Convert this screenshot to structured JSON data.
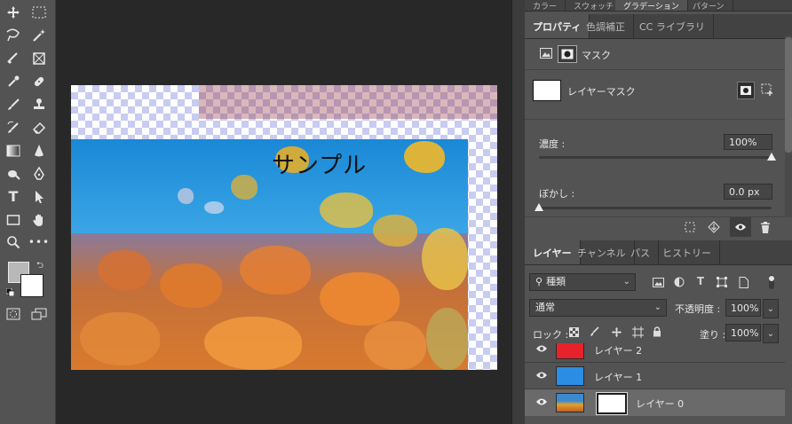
{
  "tools": [
    {
      "name": "move-tool-icon",
      "glyph": "✥"
    },
    {
      "name": "marquee-tool-icon",
      "glyph": "⬚"
    },
    {
      "name": "lasso-tool-icon",
      "glyph": "➰"
    },
    {
      "name": "magic-wand-tool-icon",
      "glyph": "✦"
    },
    {
      "name": "eyedropper-tool-icon",
      "glyph": "✒"
    },
    {
      "name": "frame-tool-icon",
      "glyph": "⊠"
    },
    {
      "name": "color-sampler-icon",
      "glyph": "✎"
    },
    {
      "name": "healing-brush-icon",
      "glyph": "✚"
    },
    {
      "name": "brush-tool-icon",
      "glyph": "✐"
    },
    {
      "name": "stamp-tool-icon",
      "glyph": "⊥"
    },
    {
      "name": "history-brush-icon",
      "glyph": "✍"
    },
    {
      "name": "eraser-tool-icon",
      "glyph": "◇"
    },
    {
      "name": "gradient-tool-icon",
      "glyph": "▣"
    },
    {
      "name": "blur-tool-icon",
      "glyph": "▲"
    },
    {
      "name": "dodge-tool-icon",
      "glyph": "●"
    },
    {
      "name": "pen-tool-icon",
      "glyph": "✑"
    },
    {
      "name": "type-tool-icon",
      "glyph": "T"
    },
    {
      "name": "path-select-tool-icon",
      "glyph": "➤"
    },
    {
      "name": "rectangle-tool-icon",
      "glyph": "▭"
    },
    {
      "name": "hand-tool-icon",
      "glyph": "✋"
    },
    {
      "name": "zoom-tool-icon",
      "glyph": "⚲"
    },
    {
      "name": "more-tools-icon",
      "glyph": "•••"
    }
  ],
  "canvas": {
    "text": "サンプル"
  },
  "top_tabs": {
    "t1": "カラー",
    "t2": "スウォッチ",
    "t3": "グラデーション",
    "t4": "パターン"
  },
  "properties": {
    "tabs": [
      "プロパティ",
      "色調補正",
      "CC ライブラリ"
    ],
    "mask_label": "マスク",
    "layer_mask_label": "レイヤーマスク",
    "density_label": "濃度 :",
    "density_value": "100%",
    "density_level": 1.0,
    "feather_label": "ぼかし :",
    "feather_value": "0.0 px",
    "feather_level": 0.0
  },
  "layers_panel": {
    "tabs": [
      "レイヤー",
      "チャンネル",
      "パス",
      "ヒストリー"
    ],
    "filter_kind": "種類",
    "blend_mode": "通常",
    "opacity_label": "不透明度 :",
    "opacity_value": "100%",
    "lock_label": "ロック :",
    "fill_label": "塗り :",
    "fill_value": "100%",
    "layers": [
      {
        "name": "レイヤー 2",
        "thumb_color": "#e8222a"
      },
      {
        "name": "レイヤー 1",
        "thumb_color": "#2b8de3"
      },
      {
        "name": "レイヤー 0",
        "thumb_color": "#3a8ad0"
      }
    ]
  },
  "colors": {
    "foreground": "#b8b8b8",
    "background": "#ffffff",
    "accent_red": "#e8222a",
    "accent_blue": "#2b8de3"
  }
}
